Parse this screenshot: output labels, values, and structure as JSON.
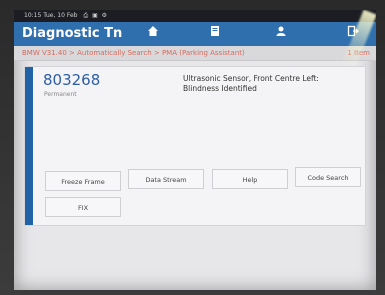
{
  "statusbar": {
    "time": "10:15",
    "date": "Tue, 10 Feb",
    "icons": "⎙ ▣ ⚙"
  },
  "header": {
    "title": "Diagnostic Tn",
    "home_icon": "home-icon",
    "report_icon": "report-icon",
    "person_icon": "person-icon",
    "exit_icon": "exit-icon"
  },
  "breadcrumb": {
    "path": "BMW V31.40 > Automatically Search > PMA (Parking Assistant)",
    "right": "1 Item"
  },
  "dtc": {
    "code": "803268",
    "status": "Permanent",
    "description": "Ultrasonic Sensor, Front Centre Left: Blindness Identified"
  },
  "buttons": {
    "freeze_frame": "Freeze Frame",
    "data_stream": "Data Stream",
    "help": "Help",
    "code_search": "Code Search",
    "fix": "FIX"
  },
  "colors": {
    "navbar": "#2f6fae",
    "accent": "#1f62a6",
    "breadcrumb_text": "#d66a5b"
  }
}
